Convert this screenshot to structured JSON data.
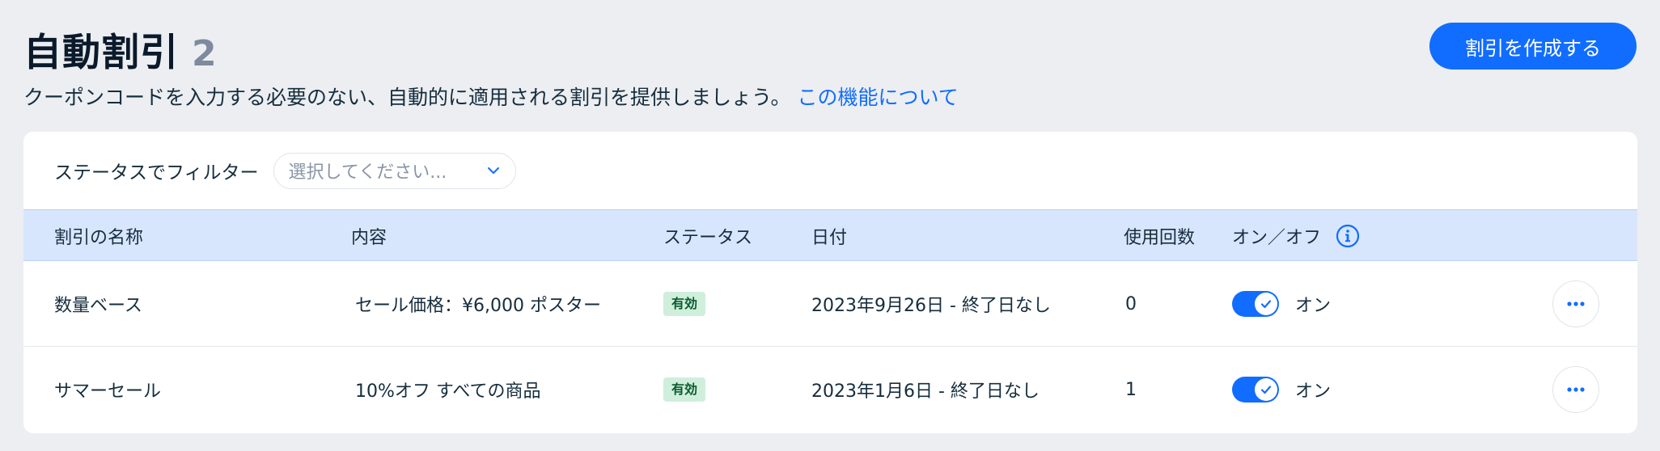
{
  "header": {
    "title": "自動割引",
    "count": "2",
    "subtitle": "クーポンコードを入力する必要のない、自動的に適用される割引を提供しましょう。",
    "learn_more_link": "この機能について",
    "create_button": "割引を作成する"
  },
  "filter": {
    "label": "ステータスでフィルター",
    "placeholder": "選択してください..."
  },
  "table": {
    "columns": {
      "name": "割引の名称",
      "content": "内容",
      "status": "ステータス",
      "date": "日付",
      "uses": "使用回数",
      "toggle": "オン／オフ"
    },
    "rows": [
      {
        "name": "数量ベース",
        "content": "セール価格：¥6,000 ポスター",
        "status": "有効",
        "date": "2023年9月26日 - 終了日なし",
        "uses": "0",
        "toggle_label": "オン",
        "toggle_on": true
      },
      {
        "name": "サマーセール",
        "content": "10%オフ すべての商品",
        "status": "有効",
        "date": "2023年1月6日 - 終了日なし",
        "uses": "1",
        "toggle_label": "オン",
        "toggle_on": true
      }
    ]
  },
  "icons": {
    "filter_dropdown": "chevron-down-icon",
    "column_info": "info-icon",
    "toggle_check": "check-icon",
    "row_menu": "more-horizontal-icon"
  },
  "colors": {
    "accent": "#116dff",
    "page_background": "#eceef2",
    "header_row": "#d8e6fd",
    "status_badge_bg": "#cfefdc",
    "status_badge_text": "#0b5a2f",
    "count_gray": "#7f8a9f"
  }
}
